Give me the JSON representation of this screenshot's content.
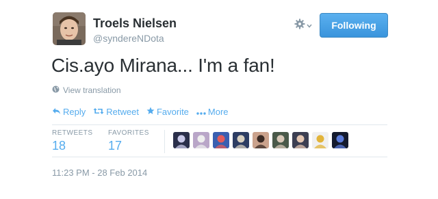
{
  "author": {
    "name": "Troels Nielsen",
    "handle": "@syndereNDota"
  },
  "header": {
    "follow_label": "Following",
    "gear_icon": "gear-icon"
  },
  "tweet": {
    "text": "Cis.ayo Mirana... I'm a fan!",
    "translate_label": "View translation"
  },
  "actions": [
    {
      "icon": "reply-icon",
      "label": "Reply"
    },
    {
      "icon": "retweet-icon",
      "label": "Retweet"
    },
    {
      "icon": "star-icon",
      "label": "Favorite"
    },
    {
      "icon": "more-icon",
      "label": "More"
    }
  ],
  "stats": {
    "retweets_label": "RETWEETS",
    "retweets_count": "18",
    "favorites_label": "FAVORITES",
    "favorites_count": "17"
  },
  "favoriters": [
    {
      "name": "favoriter-avatar-1",
      "bg": "#2a2f4a",
      "fg": "#c9c9e8"
    },
    {
      "name": "favoriter-avatar-2",
      "bg": "#b9a6c8",
      "fg": "#eeeeee"
    },
    {
      "name": "favoriter-avatar-3",
      "bg": "#3a5fb0",
      "fg": "#e25c5c"
    },
    {
      "name": "favoriter-avatar-4",
      "bg": "#2d3d63",
      "fg": "#d8d0c0"
    },
    {
      "name": "favoriter-avatar-5",
      "bg": "#caa28c",
      "fg": "#3a2a24"
    },
    {
      "name": "favoriter-avatar-6",
      "bg": "#4a5a4a",
      "fg": "#d8c8b8"
    },
    {
      "name": "favoriter-avatar-7",
      "bg": "#3c3f52",
      "fg": "#e3c6b2"
    },
    {
      "name": "favoriter-avatar-8",
      "bg": "#f0f0f0",
      "fg": "#e2b43a"
    },
    {
      "name": "favoriter-avatar-9",
      "bg": "#141a2e",
      "fg": "#5a7ad8"
    }
  ],
  "timestamp": "11:23 PM - 28 Feb 2014",
  "colors": {
    "accent": "#55acee",
    "follow_button": "#4aa0e5",
    "muted": "#8899a6"
  }
}
